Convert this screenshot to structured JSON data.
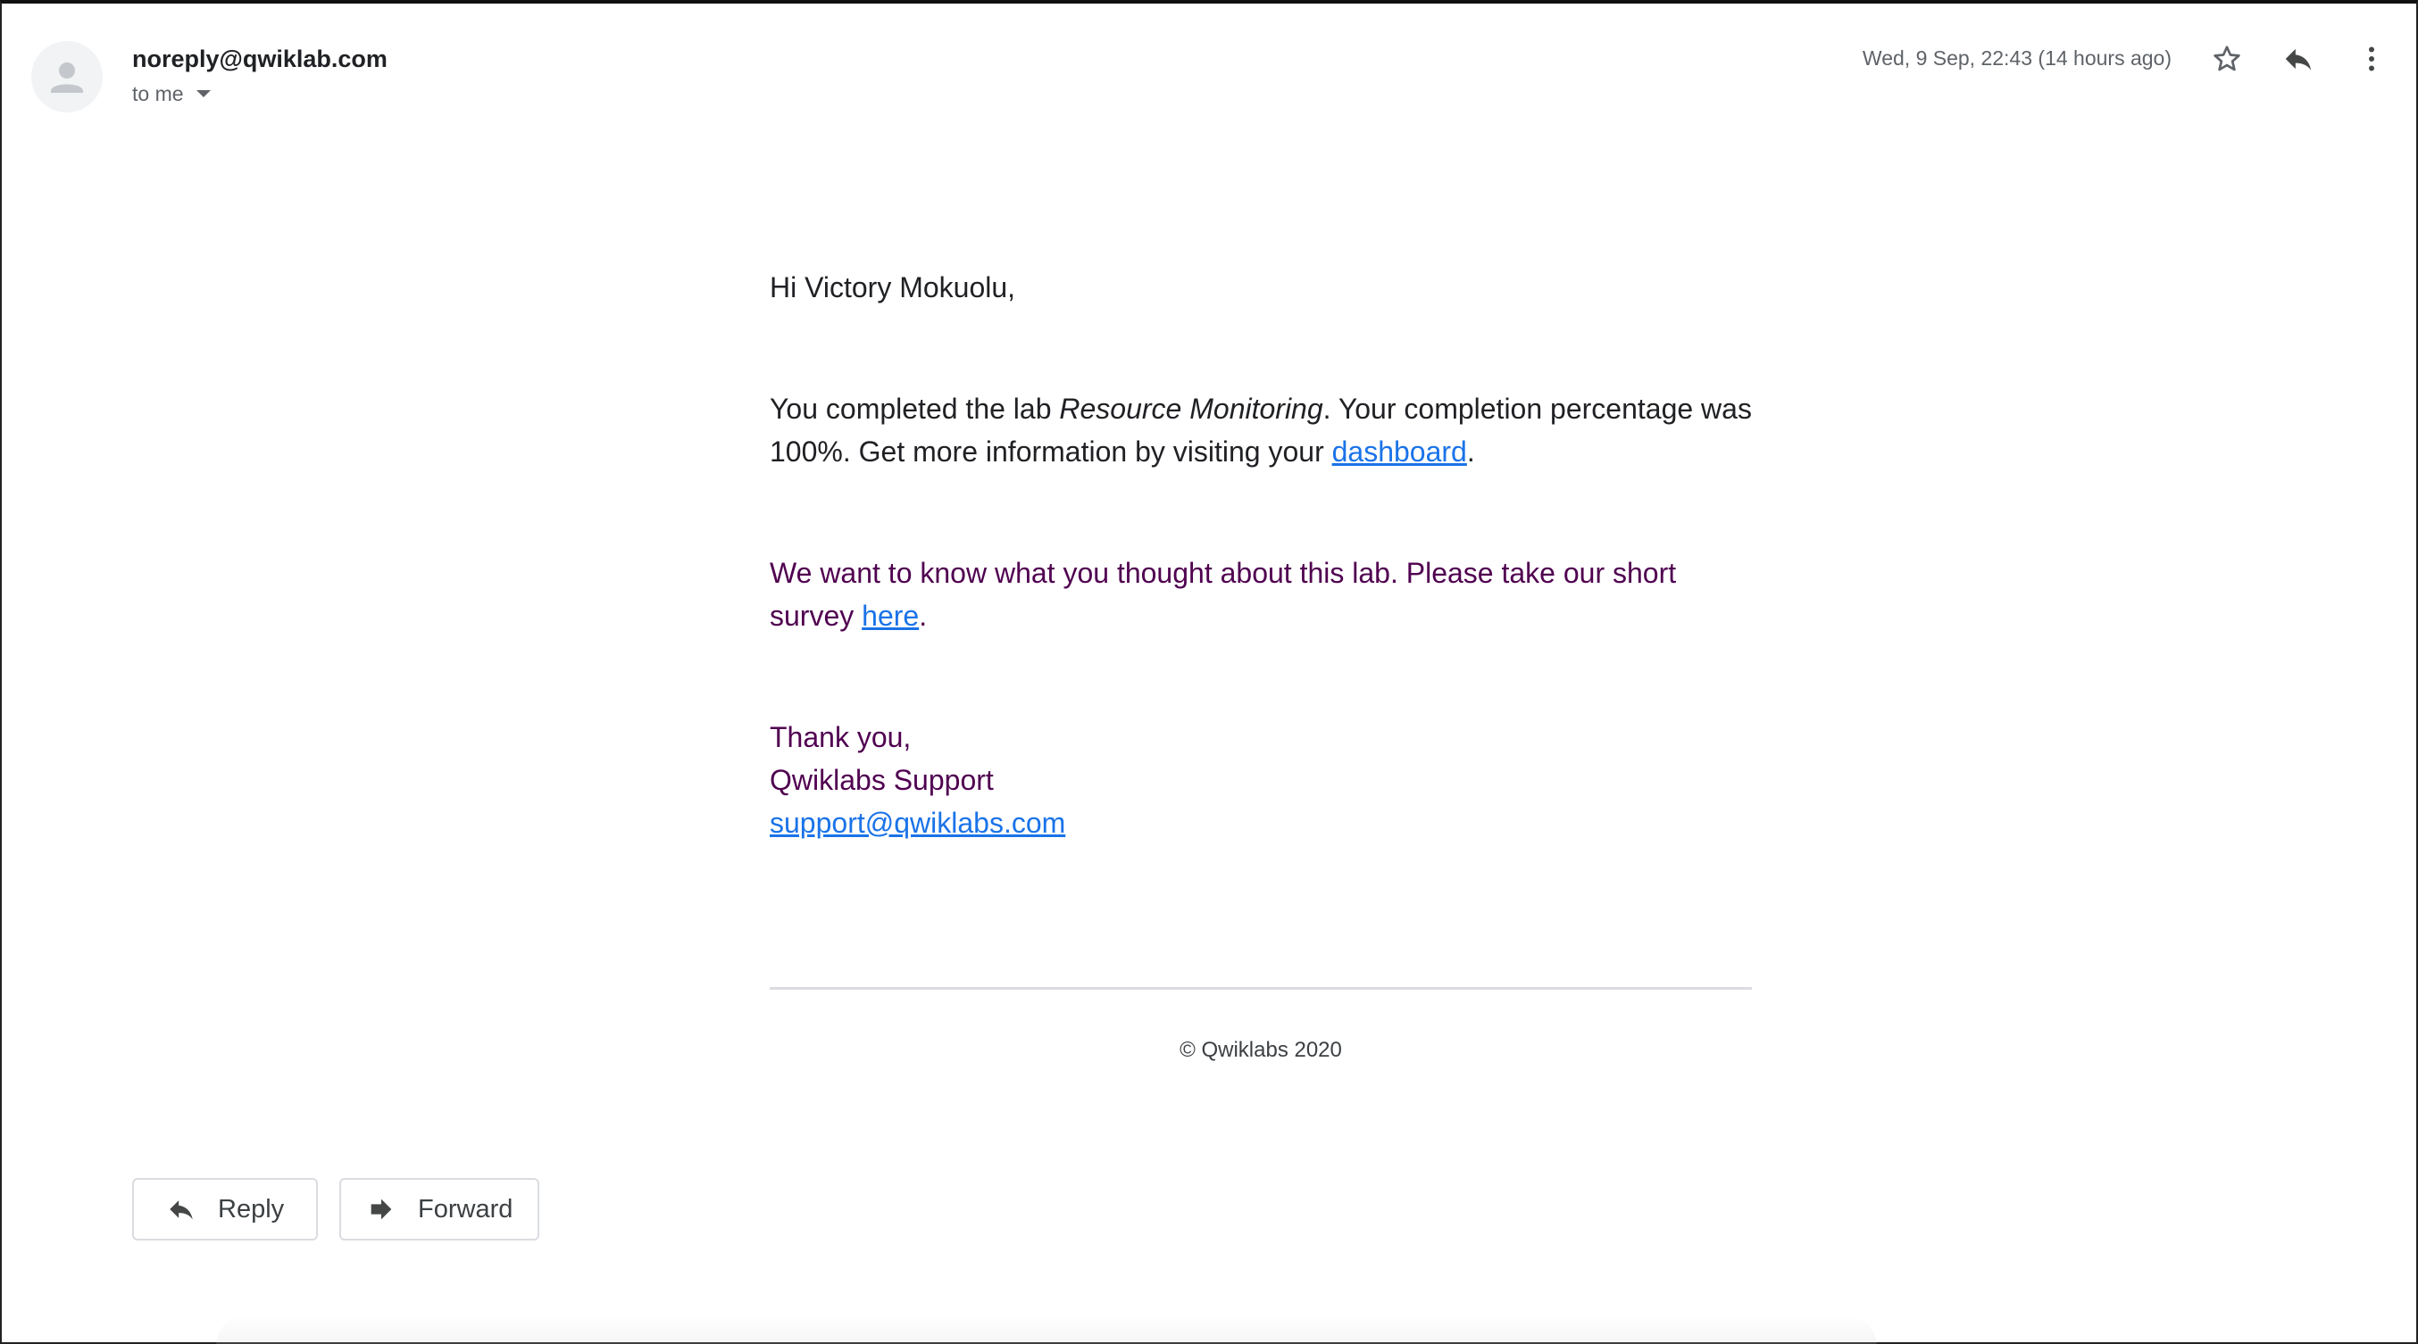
{
  "header": {
    "sender": "noreply@qwiklab.com",
    "recipient": "to me",
    "timestamp": "Wed, 9 Sep, 22:43 (14 hours ago)",
    "icons": [
      "avatar-person-icon",
      "star-icon",
      "reply-icon",
      "more-vert-icon"
    ]
  },
  "body": {
    "greeting": "Hi Victory Mokuolu,",
    "para1_before": "You completed the lab ",
    "para1_lab_name": "Resource Monitoring",
    "para1_after": ". Your completion percentage was 100%. Get more information by visiting your ",
    "para1_link": "dashboard",
    "para1_end": ".",
    "para2_before": "We want to know what you thought about this lab. Please take our short survey ",
    "para2_link": "here",
    "para2_end": ".",
    "signoff_thanks": "Thank you,",
    "signoff_team": "Qwiklabs Support",
    "signoff_email": "support@qwiklabs.com"
  },
  "footer": {
    "copyright": "© Qwiklabs 2020"
  },
  "actions": {
    "reply_label": "Reply",
    "forward_label": "Forward"
  },
  "colors": {
    "link": "#1a73e8",
    "quoted_text": "#500050",
    "secondary_text": "#5f6368"
  }
}
